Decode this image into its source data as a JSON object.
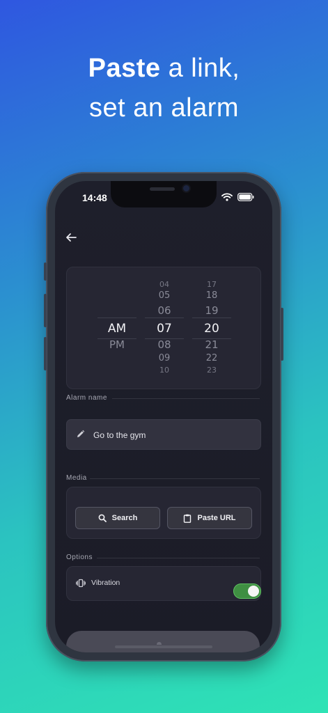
{
  "headline": {
    "bold": "Paste",
    "rest_line1": " a link,",
    "line2": "set an alarm"
  },
  "status_bar": {
    "time": "14:48"
  },
  "picker": {
    "period": {
      "above": "",
      "selected": "AM",
      "below": "PM"
    },
    "hours": {
      "above": [
        "04",
        "05",
        "06"
      ],
      "selected": "07",
      "below": [
        "08",
        "09",
        "10"
      ]
    },
    "minutes": {
      "above": [
        "17",
        "18",
        "19"
      ],
      "selected": "20",
      "below": [
        "21",
        "22",
        "23"
      ]
    }
  },
  "alarm_name": {
    "section_label": "Alarm name",
    "value": "Go to the gym"
  },
  "media": {
    "section_label": "Media",
    "search_label": "Search",
    "paste_url_label": "Paste URL"
  },
  "options": {
    "section_label": "Options",
    "vibration_label": "Vibration",
    "vibration_on": true
  }
}
